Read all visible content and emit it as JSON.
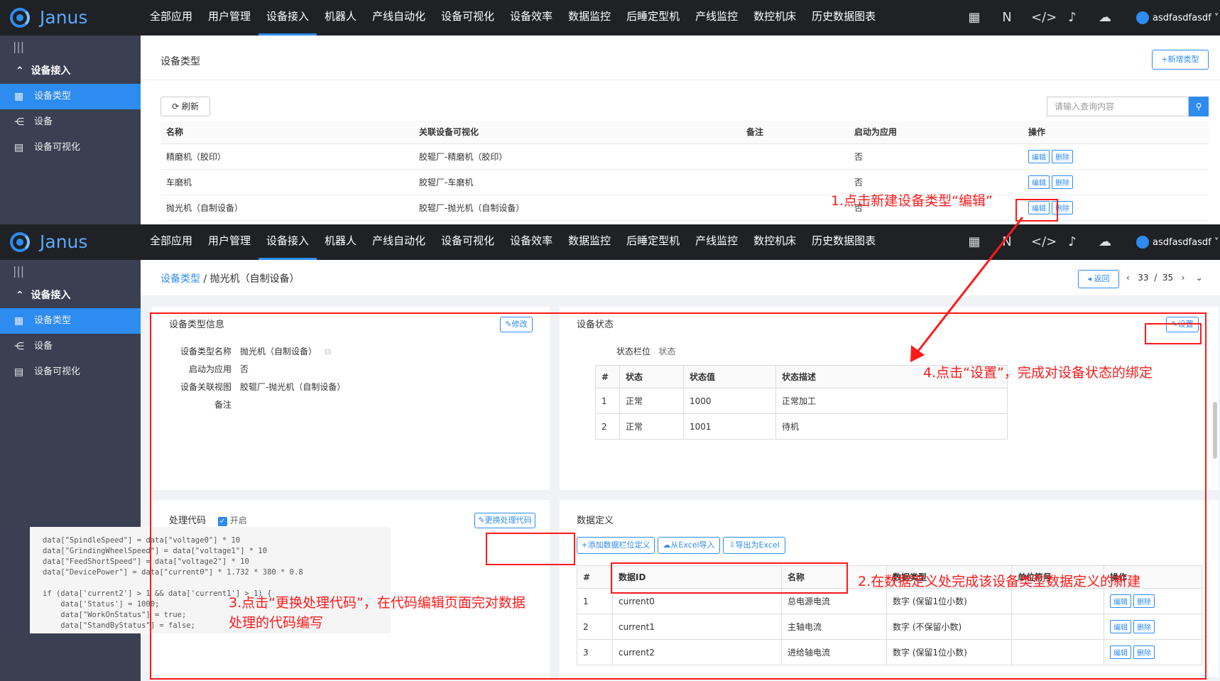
{
  "app": {
    "logo_text": "Janus",
    "user": "asdfasdfasdf"
  },
  "nav": [
    "全部应用",
    "用户管理",
    "设备接入",
    "机器人",
    "产线自动化",
    "设备可视化",
    "设备效率",
    "数据监控",
    "后睡定型机",
    "产线监控",
    "数控机床",
    "历史数据图表"
  ],
  "nav_active": "设备接入",
  "sidebar": {
    "toggle": "|||",
    "group": "设备接入",
    "items": [
      {
        "label": "设备类型",
        "icon": "grid-icon"
      },
      {
        "label": "设备",
        "icon": "device-icon"
      },
      {
        "label": "设备可视化",
        "icon": "chart-icon"
      }
    ]
  },
  "list_page": {
    "title": "设备类型",
    "add_button": "+新增类型",
    "refresh_button": "⟳ 刷新",
    "search_placeholder": "请输入查询内容",
    "columns": [
      "名称",
      "关联设备可视化",
      "备注",
      "启动为应用",
      "操作"
    ],
    "rows": [
      {
        "name": "精磨机（胶印）",
        "viz": "胶辊厂-精磨机（胶印）",
        "note": "",
        "app": "否"
      },
      {
        "name": "车磨机",
        "viz": "胶辊厂-车磨机",
        "note": "",
        "app": "否"
      },
      {
        "name": "抛光机（自制设备）",
        "viz": "胶辊厂-抛光机（自制设备）",
        "note": "",
        "app": "否"
      }
    ],
    "edit_label": "编辑",
    "delete_label": "删除"
  },
  "detail_page": {
    "breadcrumb_root": "设备类型",
    "breadcrumb_sep": "/",
    "breadcrumb_current": "抛光机（自制设备）",
    "back_button": "返回",
    "pager": {
      "current": "33",
      "sep": "/",
      "total": "35"
    },
    "info": {
      "title": "设备类型信息",
      "modify_button": "修改",
      "fields": [
        {
          "k": "设备类型名称",
          "v": "抛光机（自制设备）"
        },
        {
          "k": "启动为应用",
          "v": "否"
        },
        {
          "k": "设备关联视图",
          "v": "胶辊厂-抛光机（自制设备）"
        },
        {
          "k": "备注",
          "v": ""
        }
      ]
    },
    "status": {
      "title": "设备状态",
      "set_button": "设置",
      "field_label": "状态栏位",
      "field_value": "状态",
      "columns": [
        "#",
        "状态",
        "状态值",
        "状态描述"
      ],
      "rows": [
        {
          "n": "1",
          "s": "正常",
          "v": "1000",
          "d": "正常加工"
        },
        {
          "n": "2",
          "s": "正常",
          "v": "1001",
          "d": "待机"
        }
      ]
    },
    "code": {
      "title": "处理代码",
      "enabled_label": "开启",
      "change_button": "更换处理代码",
      "text": "data[\"SpindleSpeed\"] = data[\"voltage0\"] * 10\ndata[\"GrindingWheelSpeed\"] = data[\"voltage1\"] * 10\ndata[\"FeedShortSpeed\"] = data[\"voltage2\"] * 10\ndata[\"DevicePower\"] = data[\"current0\"] * 1.732 * 380 * 0.8\n\nif (data['current2'] > 1 && data['current1'] > 1) {\n    data['Status'] = 1000;\n    data[\"WorkOnStatus\"] = true;\n    data[\"StandByStatus\"] = false;"
    },
    "datadef": {
      "title": "数据定义",
      "add_button": "+添加数据栏位定义",
      "import_button": "从Excel导入",
      "export_button": "导出为Excel",
      "columns": [
        "#",
        "数据ID",
        "名称",
        "数据类型",
        "单位符号",
        "操作"
      ],
      "rows": [
        {
          "n": "1",
          "id": "current0",
          "name": "总电源电流",
          "type": "数字 (保留1位小数)",
          "unit": ""
        },
        {
          "n": "2",
          "id": "current1",
          "name": "主轴电流",
          "type": "数字 (不保留小数)",
          "unit": ""
        },
        {
          "n": "3",
          "id": "current2",
          "name": "进给轴电流",
          "type": "数字 (保留1位小数)",
          "unit": ""
        }
      ],
      "edit_label": "编辑",
      "delete_label": "删除"
    }
  },
  "annotations": {
    "a1": "1.点击新建设备类型“编辑”",
    "a2": "2.在数据定义处完成该设备类型数据定义的新建",
    "a3_line1": "3.点击“更换处理代码”，在代码编辑页面完对数据",
    "a3_line2": "处理的代码编写",
    "a4": "4.点击“设置”，完成对设备状态的绑定",
    "color": "#ff1a1a"
  },
  "colors": {
    "accent": "#2d8cf0",
    "topbar": "#1f2125",
    "sidebar": "#3a3f51"
  }
}
